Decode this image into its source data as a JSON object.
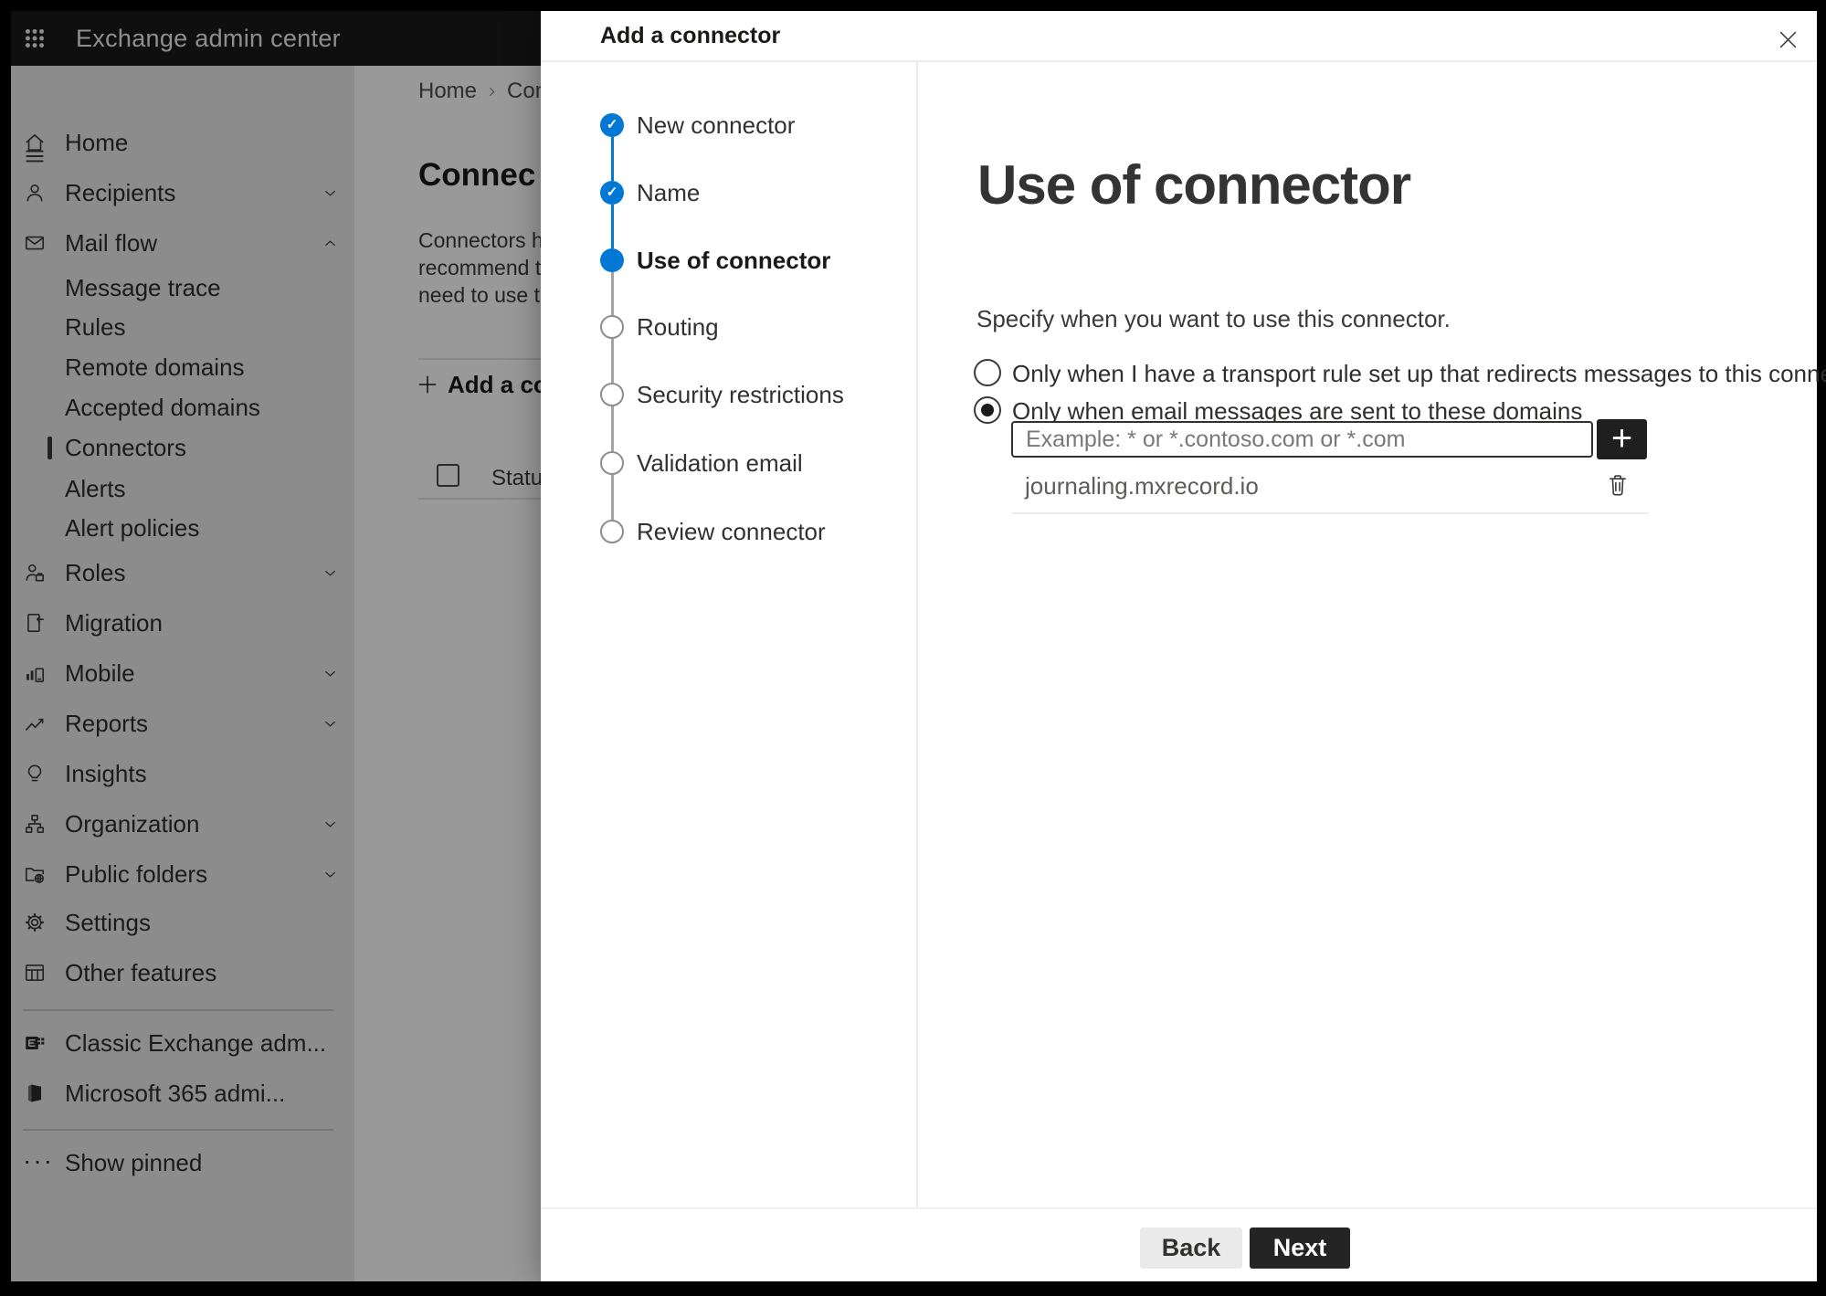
{
  "icons": {
    "check": "✓",
    "plus": "+",
    "ellipsis": "···"
  },
  "topbar": {
    "title": "Exchange admin center"
  },
  "sidebar": {
    "items": [
      {
        "label": "Home"
      },
      {
        "label": "Recipients"
      },
      {
        "label": "Mail flow"
      },
      {
        "label": "Message trace"
      },
      {
        "label": "Rules"
      },
      {
        "label": "Remote domains"
      },
      {
        "label": "Accepted domains"
      },
      {
        "label": "Connectors",
        "selected": true
      },
      {
        "label": "Alerts"
      },
      {
        "label": "Alert policies"
      },
      {
        "label": "Roles"
      },
      {
        "label": "Migration"
      },
      {
        "label": "Mobile"
      },
      {
        "label": "Reports"
      },
      {
        "label": "Insights"
      },
      {
        "label": "Organization"
      },
      {
        "label": "Public folders"
      },
      {
        "label": "Settings"
      },
      {
        "label": "Other features"
      },
      {
        "label": "Classic Exchange adm..."
      },
      {
        "label": "Microsoft 365 admi..."
      },
      {
        "label": "Show pinned"
      }
    ]
  },
  "page": {
    "breadcrumb_home": "Home",
    "breadcrumb_current": "Conne",
    "title": "Connec",
    "paragraph": [
      "Connectors help",
      "recommend that",
      "need to use ther"
    ],
    "add_button_label": "Add a conn",
    "status_column": "Status"
  },
  "dialog": {
    "title": "Add a connector",
    "steps": [
      {
        "label": "New connector",
        "state": "completed"
      },
      {
        "label": "Name",
        "state": "completed"
      },
      {
        "label": "Use of connector",
        "state": "current"
      },
      {
        "label": "Routing",
        "state": "pending"
      },
      {
        "label": "Security restrictions",
        "state": "pending"
      },
      {
        "label": "Validation email",
        "state": "pending"
      },
      {
        "label": "Review connector",
        "state": "pending"
      }
    ],
    "heading": "Use of connector",
    "instruction": "Specify when you want to use this connector.",
    "options": [
      {
        "label": "Only when I have a transport rule set up that redirects messages to this connector",
        "selected": false
      },
      {
        "label": "Only when email messages are sent to these domains",
        "selected": true
      }
    ],
    "domain_placeholder": "Example: * or *.contoso.com or *.com",
    "domains": [
      "journaling.mxrecord.io"
    ],
    "back_label": "Back",
    "next_label": "Next"
  },
  "colors": {
    "accent": "#0078d4",
    "topbar_bg": "#1a1a1a",
    "next_bg": "#242424",
    "dim": "rgba(0,0,0,0.40)"
  }
}
